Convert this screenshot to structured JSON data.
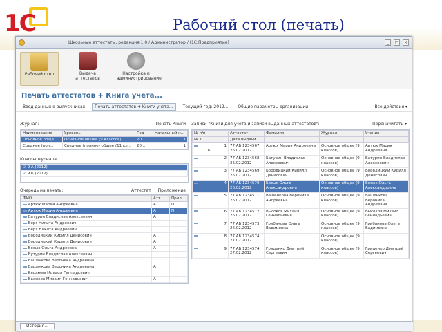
{
  "slide": {
    "title": "Рабочий стол (печать)",
    "logo_text": "1С"
  },
  "window": {
    "title": "Школьные аттестаты, редакция 1.0 / Администратор / (1С:Предприятие)",
    "history": "История..."
  },
  "panel": [
    {
      "label": "Рабочий стол",
      "icon": "desktop-icon"
    },
    {
      "label": "Выдача аттестатов",
      "icon": "certificate-icon"
    },
    {
      "label": "Настройка и администрирование",
      "icon": "settings-icon"
    }
  ],
  "form": {
    "title": "Печать аттестатов + Книга учета..."
  },
  "toolbar": {
    "input_data": "Ввод данных о выпускниках",
    "print_tab": "Печать аттестатов + Книги учета...",
    "year": "Текущий год: 2012...",
    "org": "Общие параметры организации",
    "all_actions": "Все действия"
  },
  "journal": {
    "label": "Журнал:",
    "print_book": "Печать Книги",
    "columns": [
      "Наименование",
      "Уровень",
      "Год",
      "Начальный н..."
    ],
    "rows": [
      [
        "Основное обще...",
        "Основное общее (9 классов)",
        "20...",
        "1"
      ],
      [
        "Среднее (пол...",
        "Среднее (полное) общее (11 кл...",
        "20...",
        "1"
      ]
    ]
  },
  "classes": {
    "label": "Классы журнала:",
    "items": [
      "9 А (2012)",
      "9 Б (2012)"
    ]
  },
  "queue": {
    "label": "Очередь на печать:",
    "attest_btn": "Аттестат",
    "app_btn": "Приложение",
    "columns": [
      "ФИО",
      "Атт",
      "Прил."
    ],
    "rows": [
      [
        "Артюх Мария Андреевна",
        "А",
        "П"
      ],
      [
        "Артюх Мария Андреевна",
        "А",
        "П"
      ],
      [
        "Батурин Владислав Алексеевич",
        "А",
        ""
      ],
      [
        "Берг Никита Андреевич",
        "",
        ""
      ],
      [
        "Берх Никита Андреевич",
        "",
        ""
      ],
      [
        "Бородицкий Кирилл Денисович",
        "А",
        ""
      ],
      [
        "Бородицкий Кирилл Денисович",
        "А",
        ""
      ],
      [
        "Босых Ольга Андреевна",
        "А",
        ""
      ],
      [
        "Бутурин Владислав Алексеевич",
        "",
        ""
      ],
      [
        "Вашенкова Вероника Андреевна",
        "",
        ""
      ],
      [
        "Вашенкова Вероника Андреевна",
        "А",
        ""
      ],
      [
        "Вошиков Михаил Геннадьевич",
        "",
        ""
      ],
      [
        "Высоков Михаил Геннадьевич",
        "А",
        ""
      ]
    ]
  },
  "records": {
    "label": "Записи \"Книги для учета и записи выданных аттестатов\":",
    "rearrange": "Переначитать",
    "columns": [
      "№ п/п",
      "Аттестат",
      "Фамилия",
      "Журнал",
      "Ученик"
    ],
    "subcols": [
      "№ к",
      "Дата выдачи"
    ],
    "rows": [
      [
        "1",
        "77 АБ 1234567",
        "26.02.2012",
        "Артюх Мария Андреевна",
        "Основное общее (9 классов)",
        "Артюх Мария Андреевна",
        "6"
      ],
      [
        "2",
        "77 АБ 1234568",
        "26.02.2012",
        "Батурин Владислав Алексеевич",
        "Основное общее (9 классов)",
        "Батурин Владислав Алексеевич",
        ""
      ],
      [
        "3",
        "77 АБ 1234569",
        "26.02.2012",
        "Бородицкий Кирилл Денисович",
        "Основное общее (9 классов)",
        "Бородицкий Кирилл Денисович",
        ""
      ],
      [
        "4",
        "77 АБ 1234570",
        "26.02.2012",
        "Босых Ольга Александровна",
        "Основное общее (9 классов)",
        "Босых Ольга Александровна",
        ""
      ],
      [
        "5",
        "77 АБ 1234571",
        "26.02.2012",
        "Вашенкова Вероника Андреевна",
        "Основное общее (9 классов)",
        "Вашенкова Вероника Андреевна",
        ""
      ],
      [
        "6",
        "77 АБ 1234572",
        "26.02.2012",
        "Высоков Михаил Геннадьевич",
        "Основное общее (9 классов)",
        "Высоков Михаил Геннадьевич",
        ""
      ],
      [
        "7",
        "77 АБ 1234573",
        "26.02.2012",
        "Грибанова Ольга Вадимовна",
        "Основное общее (9 классов)",
        "Грибанова Ольга Вадимовна",
        ""
      ],
      [
        "8",
        "77 АБ 1234574",
        "27.02.2012",
        "",
        "Основное общее (9 классов)",
        "",
        ""
      ],
      [
        "9",
        "77 АБ 1234574",
        "27.02.2012",
        "Гриценко Дмитрий Сергеевич",
        "Основное общее (9 классов)",
        "Гриценко Дмитрий Сергеевич",
        ""
      ]
    ]
  }
}
